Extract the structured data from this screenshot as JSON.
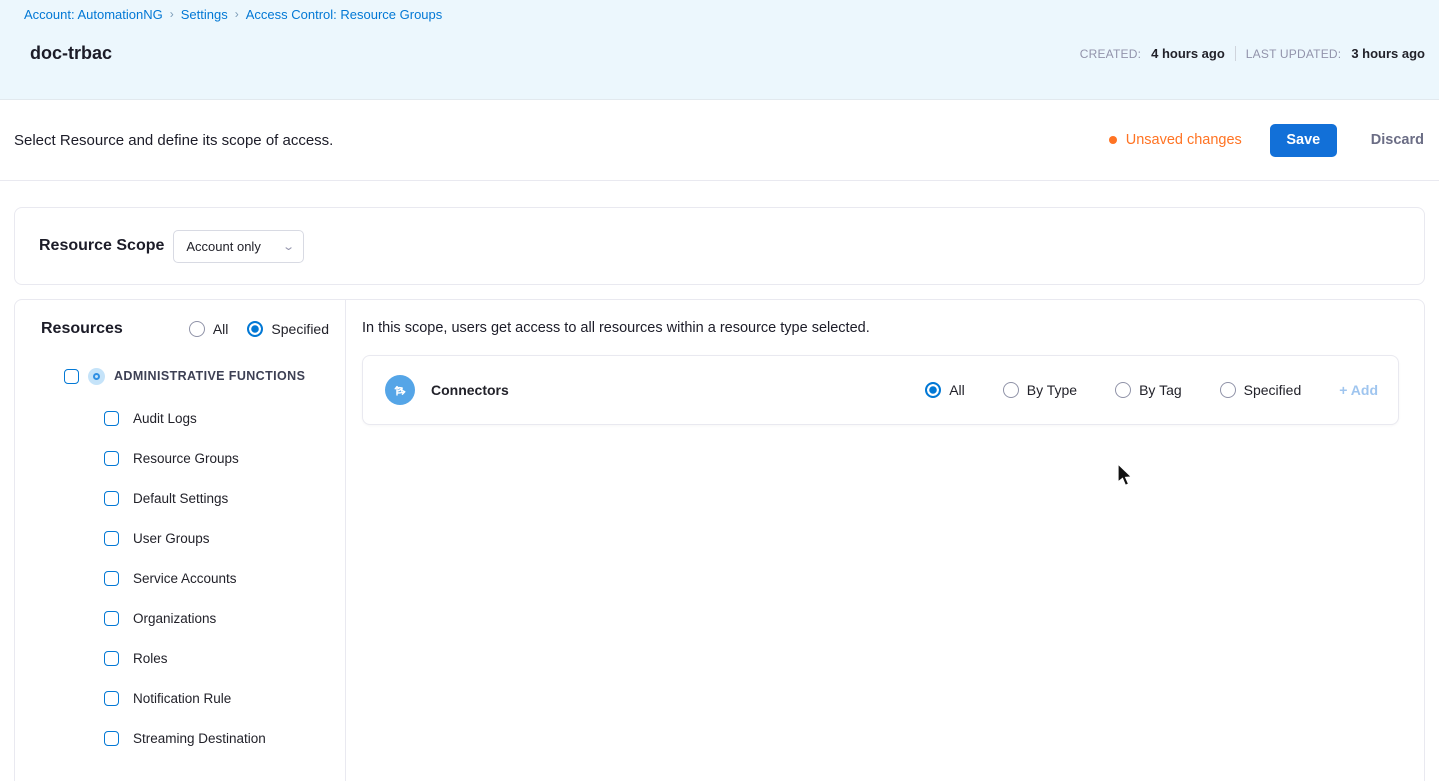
{
  "colors": {
    "accent_blue": "#0278d5",
    "save_button_blue": "#1270d8",
    "unsaved_orange": "#ff7323",
    "connector_icon_blue": "#55a5e7",
    "header_background": "#ecf7fd"
  },
  "breadcrumb": {
    "separator": "›",
    "items": [
      "Account: AutomationNG",
      "Settings",
      "Access Control: Resource Groups"
    ]
  },
  "header": {
    "title": "doc-trbac",
    "created_label": "CREATED:",
    "created_value": "4 hours ago",
    "updated_label": "LAST UPDATED:",
    "updated_value": "3 hours ago"
  },
  "toolbar": {
    "description": "Select Resource and define its scope of access.",
    "unsaved_label": "Unsaved changes",
    "save_label": "Save",
    "discard_label": "Discard"
  },
  "resource_scope": {
    "heading": "Resource Scope",
    "selected_option": "Account only",
    "chevron_icon": "⌄"
  },
  "resources": {
    "heading": "Resources",
    "mode_options": [
      {
        "label": "All",
        "selected": false
      },
      {
        "label": "Specified",
        "selected": true
      }
    ],
    "group": {
      "label": "ADMINISTRATIVE FUNCTIONS",
      "checked": false
    },
    "items": [
      "Audit Logs",
      "Resource Groups",
      "Default Settings",
      "User Groups",
      "Service Accounts",
      "Organizations",
      "Roles",
      "Notification Rule",
      "Streaming Destination"
    ]
  },
  "scope_description": "In this scope, users get access to all resources within a resource type selected.",
  "connectors_row": {
    "label": "Connectors",
    "icon": "branch-arrows",
    "options": [
      {
        "label": "All",
        "selected": true
      },
      {
        "label": "By Type",
        "selected": false
      },
      {
        "label": "By Tag",
        "selected": false
      },
      {
        "label": "Specified",
        "selected": false
      }
    ],
    "add_label": "+ Add"
  }
}
